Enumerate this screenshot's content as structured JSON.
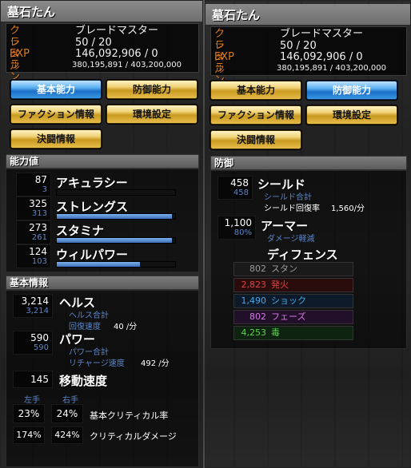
{
  "colors": {
    "accent_orange": "#e07a18",
    "blue_text": "#5b86c9",
    "gold_button": "#e5bc4a",
    "blue_button": "#3a96e0"
  },
  "panel_left": {
    "title": "墓石たん",
    "info": [
      {
        "label": "クラス",
        "value": "ブレードマスター"
      },
      {
        "label": "レベル",
        "value": "50 / 20"
      },
      {
        "label": "EXP",
        "value": "146,092,906 / 0"
      },
      {
        "label": "ランク",
        "value": "380,195,891 / 403,200,000"
      }
    ],
    "buttons": {
      "basic": "基本能力",
      "defense": "防御能力",
      "faction": "ファクション情報",
      "env": "環境設定",
      "duel": "決闘情報"
    },
    "abilities": {
      "header": "能力値",
      "stats": [
        {
          "name": "アキュラシー",
          "value": "87",
          "bonus": "3",
          "fill": 0.0
        },
        {
          "name": "ストレングス",
          "value": "325",
          "bonus": "313",
          "fill": 0.97
        },
        {
          "name": "スタミナ",
          "value": "273",
          "bonus": "261",
          "fill": 0.97
        },
        {
          "name": "ウィルパワー",
          "value": "124",
          "bonus": "103",
          "fill": 0.7
        }
      ]
    },
    "basic_info": {
      "header": "基本情報",
      "health": {
        "value": "3,214",
        "sub": "3,214",
        "name": "ヘルス",
        "l1": "ヘルス合計",
        "l2": "回復速度",
        "l2v": "40 /分"
      },
      "power": {
        "value": "590",
        "sub": "590",
        "name": "パワー",
        "l1": "パワー合計",
        "l2": "リチャージ速度",
        "l2v": "492 /分"
      },
      "move": {
        "value": "145",
        "name": "移動速度"
      },
      "left_hand": "左手",
      "right_hand": "右手",
      "crit_l": "23%",
      "crit_r": "24%",
      "crit_label": "基本クリティカル率",
      "critdmg_l": "174%",
      "critdmg_r": "424%",
      "critdmg_label": "クリティカルダメージ"
    }
  },
  "panel_right": {
    "title": "墓石たん",
    "info": [
      {
        "label": "クラス",
        "value": "ブレードマスター"
      },
      {
        "label": "レベル",
        "value": "50 / 20"
      },
      {
        "label": "EXP",
        "value": "146,092,906 / 0"
      },
      {
        "label": "ランク",
        "value": "380,195,891 / 403,200,000"
      }
    ],
    "buttons": {
      "basic": "基本能力",
      "defense": "防御能力",
      "faction": "ファクション情報",
      "env": "環境設定",
      "duel": "決闘情報"
    },
    "defense": {
      "header": "防御",
      "shield": {
        "value": "458",
        "sub": "458",
        "name": "シールド",
        "l1": "シールド合計",
        "l2": "シールド回復率",
        "l2v": "1,560/分"
      },
      "armor": {
        "value": "1,100",
        "sub": "80%",
        "name": "アーマー",
        "l1": "ダメージ軽減"
      },
      "def_title": "ディフェンス",
      "rows": [
        {
          "value": "802",
          "name": "スタン",
          "color": "#9a9a9a",
          "bg": "#1a1a1a"
        },
        {
          "value": "2,823",
          "name": "発火",
          "color": "#e04040",
          "bg": "#2a0c0c"
        },
        {
          "value": "1,490",
          "name": "ショック",
          "color": "#4aa8e8",
          "bg": "#0c1a2a"
        },
        {
          "value": "802",
          "name": "フェーズ",
          "color": "#d878e8",
          "bg": "#22102a"
        },
        {
          "value": "4,253",
          "name": "毒",
          "color": "#5ed050",
          "bg": "#0e2410"
        }
      ]
    }
  }
}
